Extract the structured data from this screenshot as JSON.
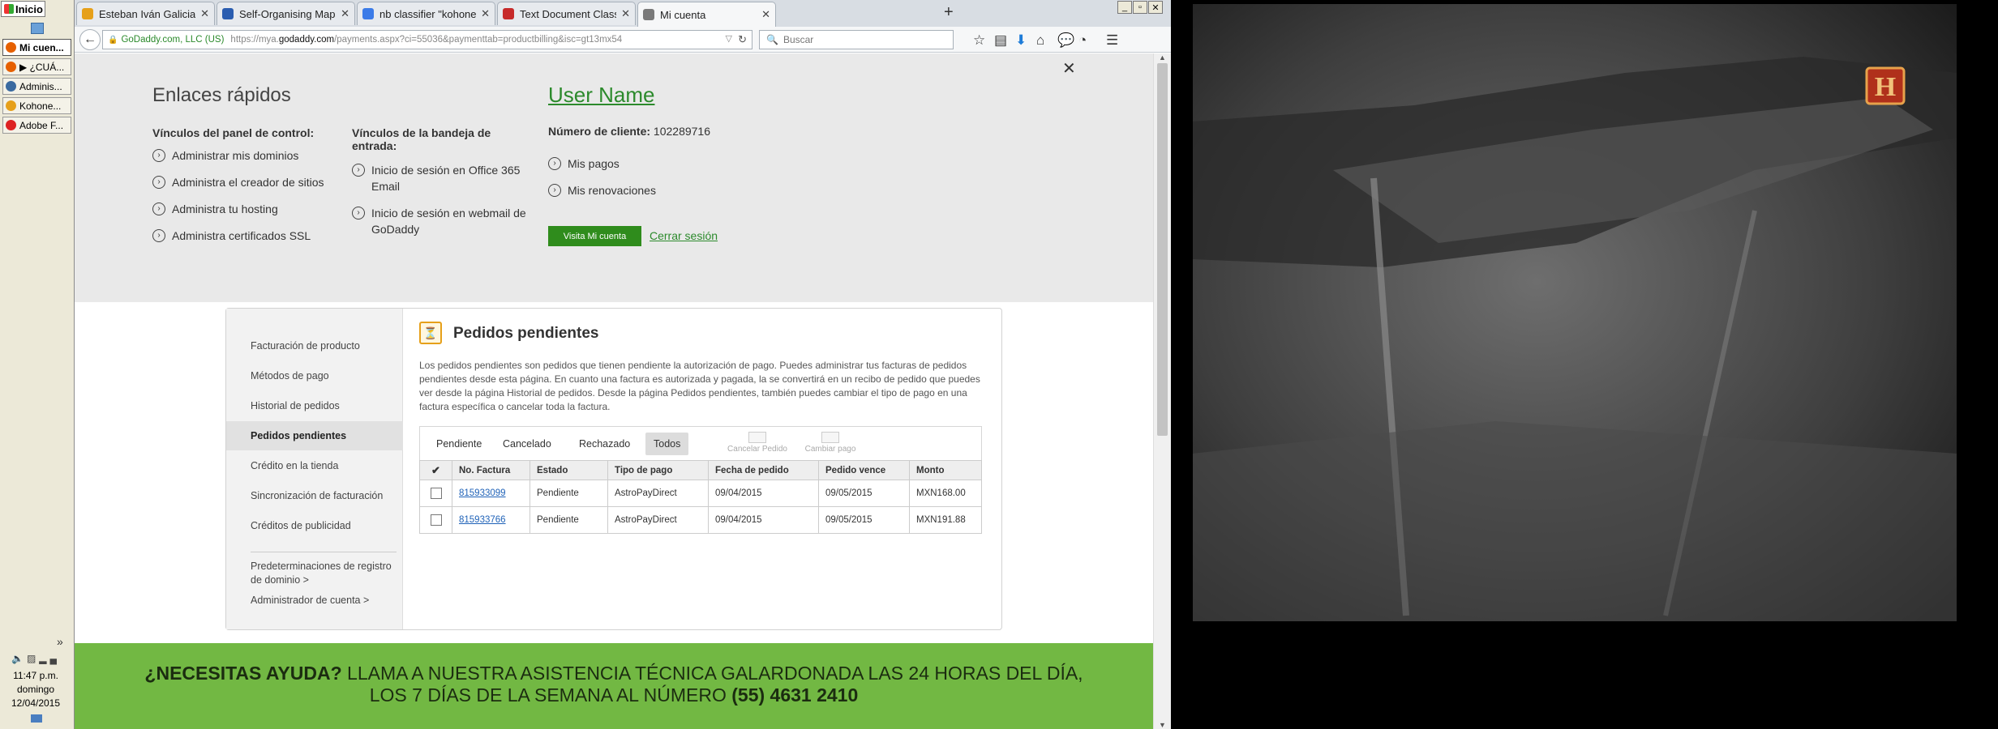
{
  "taskbar": {
    "start_label": "Inicio",
    "buttons": [
      {
        "label": "Mi cuen...",
        "active": true,
        "icon_color": "#e66000"
      },
      {
        "label": "▶ ¿CUÁ...",
        "active": false,
        "icon_color": "#e66000"
      },
      {
        "label": "Adminis...",
        "active": false,
        "icon_color": "#3a6aa0"
      },
      {
        "label": "Kohone...",
        "active": false,
        "icon_color": "#e6a01a"
      },
      {
        "label": "Adobe F...",
        "active": false,
        "icon_color": "#d22"
      }
    ],
    "chevron": "»",
    "clock": {
      "time": "11:47 p.m.",
      "day": "domingo",
      "date": "12/04/2015"
    }
  },
  "browser": {
    "tabs": [
      {
        "label": "Esteban Iván Galicia Romo ...",
        "icon": "mail-icon",
        "color": "#e6a01a",
        "active": false
      },
      {
        "label": "Self-Organising Maps in D...",
        "icon": "page-icon",
        "color": "#2a5db0",
        "active": false
      },
      {
        "label": "nb classifier \"kohonen\" - B...",
        "icon": "google-icon",
        "color": "#3b7be8",
        "active": false
      },
      {
        "label": "Text Document Classificati...",
        "icon": "pdf-icon",
        "color": "#c72a2a",
        "active": false
      },
      {
        "label": "Mi cuenta",
        "icon": "godaddy-icon",
        "color": "#7a7a7a",
        "active": true
      }
    ],
    "identity": "GoDaddy.com, LLC (US)",
    "url_prefix": "https://mya.",
    "url_host": "godaddy.com",
    "url_suffix": "/payments.aspx?ci=55036&paymenttab=productbilling&isc=gt13mx54",
    "search_placeholder": "Buscar"
  },
  "quick_links": {
    "title": "Enlaces rápidos",
    "panel_heading": "Vínculos del panel de control:",
    "panel_links": [
      "Administrar mis dominios",
      "Administra el creador de sitios",
      "Administra tu hosting",
      "Administra certificados SSL"
    ],
    "inbox_heading": "Vínculos de la bandeja de entrada:",
    "inbox_links": [
      "Inicio de sesión en Office 365 Email",
      "Inicio de sesión en webmail de GoDaddy"
    ],
    "user_name": "User Name",
    "client_label": "Número de cliente:",
    "client_number": "102289716",
    "account_links": [
      "Mis pagos",
      "Mis renovaciones"
    ],
    "visit_button": "Visita Mi cuenta",
    "logout": "Cerrar sesión"
  },
  "billing": {
    "sidenav": [
      "Facturación de producto",
      "Métodos de pago",
      "Historial de pedidos",
      "Pedidos pendientes",
      "Crédito en la tienda",
      "Sincronización de facturación",
      "Créditos de publicidad"
    ],
    "sidenav_active": "Pedidos pendientes",
    "sidenav_extra": [
      "Predeterminaciones de registro de dominio  >",
      "Administrador de cuenta    >"
    ],
    "title": "Pedidos pendientes",
    "description": "Los pedidos pendientes son pedidos que tienen pendiente la autorización de pago. Puedes administrar tus facturas de pedidos pendientes desde esta página. En cuanto una factura es autorizada y pagada, la se convertirá en un recibo de pedido que puedes ver desde la página Historial de pedidos. Desde la página Pedidos pendientes, también puedes cambiar el tipo de pago en una factura específica o cancelar toda la factura.",
    "filters": [
      "Pendiente",
      "Cancelado",
      "Rechazado",
      "Todos"
    ],
    "filter_active": "Todos",
    "actions": [
      "Cancelar Pedido",
      "Cambiar pago"
    ],
    "columns": [
      "No. Factura",
      "Estado",
      "Tipo de pago",
      "Fecha de pedido",
      "Pedido vence",
      "Monto"
    ],
    "rows": [
      [
        "815933099",
        "Pendiente",
        "AstroPayDirect",
        "09/04/2015",
        "09/05/2015",
        "MXN168.00"
      ],
      [
        "815933766",
        "Pendiente",
        "AstroPayDirect",
        "09/04/2015",
        "09/05/2015",
        "MXN191.88"
      ]
    ]
  },
  "help_banner": {
    "lead": "¿NECESITAS AYUDA?",
    "line1": " LLAMA A NUESTRA ASISTENCIA TÉCNICA GALARDONADA LAS 24 HORAS DEL DÍA,",
    "line2": "LOS 7 DÍAS DE LA SEMANA AL NÚMERO ",
    "phone": "(55) 4631 2410"
  },
  "video": {
    "channel_logo": "H"
  },
  "colors": {
    "godaddy_green": "#2c8a2c",
    "banner_green": "#72b843",
    "button_green": "#2f8c1c",
    "link_blue": "#1f62b8"
  }
}
